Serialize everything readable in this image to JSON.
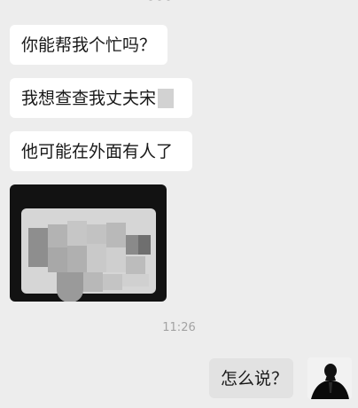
{
  "chat": {
    "messages": [
      {
        "text": "你能帮我个忙吗？"
      },
      {
        "text": "我想查查我丈夫宋"
      },
      {
        "text": "他可能在外面有人了"
      }
    ],
    "timestamp": "11:26",
    "my_reply": "怎么说？"
  },
  "colors": {
    "background": "#ededed",
    "incoming_bubble": "#ffffff",
    "outgoing_bubble": "#e2e2e2",
    "timestamp": "#a3a3a3"
  },
  "icons": {
    "avatar": "person-silhouette-avatar",
    "photo": "blurred-card-photo"
  }
}
